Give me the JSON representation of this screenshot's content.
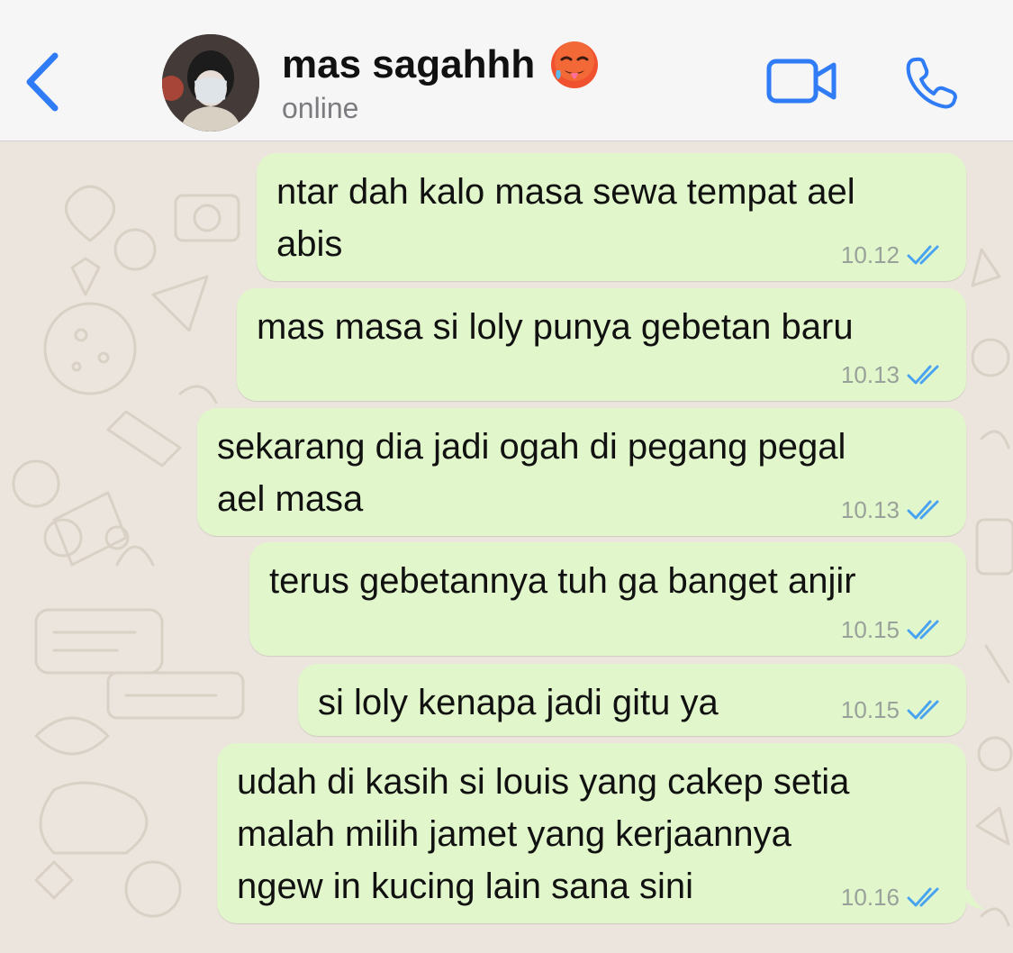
{
  "header": {
    "contact_name": "mas sagahhh",
    "status": "online",
    "back_icon": "chevron-left-icon",
    "video_icon": "video-camera-icon",
    "call_icon": "phone-icon",
    "name_emoji": "hot-face-emoji",
    "accent_color": "#2f7cf6"
  },
  "messages": [
    {
      "text": "ntar dah kalo masa sewa tempat ael\nabis",
      "time": "10.12",
      "status": "read"
    },
    {
      "text": "mas masa si loly punya gebetan baru",
      "time": "10.13",
      "status": "read"
    },
    {
      "text": "sekarang dia jadi ogah di pegang pegal\nael masa",
      "time": "10.13",
      "status": "read"
    },
    {
      "text": "terus gebetannya tuh ga banget anjir",
      "time": "10.15",
      "status": "read"
    },
    {
      "text": "si loly kenapa jadi gitu ya",
      "time": "10.15",
      "status": "read"
    },
    {
      "text": "udah di kasih si louis yang cakep setia\nmalah milih jamet yang kerjaannya\nngew in kucing lain sana sini",
      "time": "10.16",
      "status": "read"
    }
  ],
  "colors": {
    "outgoing_bubble": "#e1f7cb",
    "chat_background": "#ece5dd",
    "read_tick": "#4aa3f0"
  }
}
